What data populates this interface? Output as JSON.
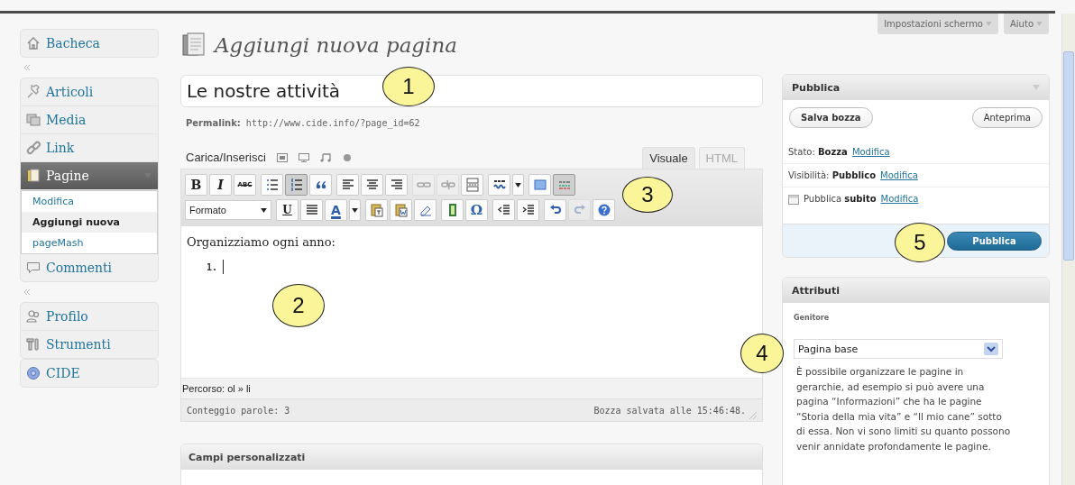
{
  "top_buttons": [
    {
      "label": "Impostazioni schermo"
    },
    {
      "label": "Aiuto"
    }
  ],
  "sidebar": {
    "groups": [
      {
        "separator_after": true,
        "items": [
          {
            "label": "Bacheca",
            "kind": "home",
            "selected": false
          }
        ]
      },
      {
        "separator_after": true,
        "items": [
          {
            "label": "Articoli",
            "kind": "pin",
            "selected": false
          },
          {
            "label": "Media",
            "kind": "media",
            "selected": false
          },
          {
            "label": "Link",
            "kind": "link",
            "selected": false
          },
          {
            "label": "Pagine",
            "kind": "pages",
            "selected": true,
            "children": [
              {
                "label": "Modifica",
                "selected": false
              },
              {
                "label": "Aggiungi nuova",
                "selected": true
              },
              {
                "label": "pageMash",
                "selected": false
              }
            ]
          },
          {
            "label": "Commenti",
            "kind": "comment",
            "selected": false
          }
        ]
      },
      {
        "separator_after": false,
        "items": [
          {
            "label": "Profilo",
            "kind": "users",
            "selected": false
          },
          {
            "label": "Strumenti",
            "kind": "tools",
            "selected": false
          }
        ]
      },
      {
        "separator_after": false,
        "items": [
          {
            "label": "CIDE",
            "kind": "flower",
            "selected": false
          }
        ]
      }
    ]
  },
  "page_title": "Aggiungi nuova pagina",
  "title_field": {
    "value": "Le nostre attività"
  },
  "permalink": {
    "label": "Permalink:",
    "url": "http://www.cide.info/?page_id=62"
  },
  "upload": {
    "label": "Carica/Inserisci"
  },
  "editor_tabs": [
    {
      "label": "Visuale",
      "selected": true
    },
    {
      "label": "HTML",
      "selected": false
    }
  ],
  "toolbar": {
    "rows": [
      {
        "groups": [
          {
            "buttons": [
              {
                "kind": "bold",
                "label": "B",
                "selected": false,
                "disabled": false
              },
              {
                "kind": "italic",
                "label": "I",
                "selected": false,
                "disabled": false
              },
              {
                "kind": "strike",
                "label": "ABC",
                "selected": false,
                "disabled": false
              }
            ]
          },
          {
            "buttons": [
              {
                "kind": "bullet-list",
                "selected": false,
                "disabled": false
              },
              {
                "kind": "numbered-list",
                "selected": true,
                "disabled": false
              },
              {
                "kind": "quote",
                "selected": false,
                "disabled": false
              }
            ]
          },
          {
            "buttons": [
              {
                "kind": "align-left",
                "selected": false,
                "disabled": false
              },
              {
                "kind": "align-center",
                "selected": false,
                "disabled": false
              },
              {
                "kind": "align-right",
                "selected": false,
                "disabled": false
              }
            ]
          },
          {
            "buttons": [
              {
                "kind": "link",
                "selected": false,
                "disabled": true
              },
              {
                "kind": "unlink",
                "selected": false,
                "disabled": true
              },
              {
                "kind": "page-break",
                "selected": false,
                "disabled": false
              }
            ]
          },
          {
            "buttons": [
              {
                "kind": "spelling",
                "selected": false,
                "disabled": false
              },
              {
                "kind": "dropdown",
                "selected": false,
                "disabled": false
              }
            ]
          },
          {
            "buttons": [
              {
                "kind": "fullscreen",
                "selected": false,
                "disabled": false
              },
              {
                "kind": "toolbar-toggle",
                "selected": true,
                "disabled": false
              }
            ]
          }
        ]
      },
      {
        "groups": [
          {
            "buttons": [
              {
                "kind": "format-select",
                "label": "Formato"
              }
            ]
          },
          {
            "buttons": [
              {
                "kind": "underline",
                "label": "U",
                "selected": false,
                "disabled": false
              },
              {
                "kind": "justify",
                "selected": false,
                "disabled": false
              },
              {
                "kind": "text-color",
                "label": "A",
                "selected": false,
                "disabled": false
              },
              {
                "kind": "dropdown",
                "selected": false,
                "disabled": false
              }
            ]
          },
          {
            "buttons": [
              {
                "kind": "paste-text",
                "selected": false,
                "disabled": false
              },
              {
                "kind": "paste-word",
                "selected": false,
                "disabled": false
              },
              {
                "kind": "eraser",
                "selected": false,
                "disabled": false
              }
            ]
          },
          {
            "buttons": [
              {
                "kind": "film",
                "selected": false,
                "disabled": false
              },
              {
                "kind": "symbol",
                "label": "Ω",
                "selected": false,
                "disabled": false
              }
            ]
          },
          {
            "buttons": [
              {
                "kind": "outdent",
                "selected": false,
                "disabled": false
              },
              {
                "kind": "indent",
                "selected": false,
                "disabled": false
              }
            ]
          },
          {
            "buttons": [
              {
                "kind": "undo",
                "selected": false,
                "disabled": false
              },
              {
                "kind": "redo",
                "selected": false,
                "disabled": true
              },
              {
                "kind": "help",
                "selected": false,
                "disabled": false
              }
            ]
          }
        ]
      }
    ]
  },
  "content": {
    "paragraph": "Organizziamo ogni anno:",
    "list_markers": [
      "1."
    ]
  },
  "path": "Percorso: ol » li",
  "status": {
    "word_count": "Conteggio parole: 3",
    "saved": "Bozza salvata alle 15:46:48."
  },
  "custom_fields": {
    "title": "Campi personalizzati"
  },
  "publish": {
    "title": "Pubblica",
    "save_draft": "Salva bozza",
    "preview": "Anteprima",
    "rows": [
      {
        "kind": "status",
        "text": "Stato: **Bozza**",
        "link": "Modifica"
      },
      {
        "kind": "status",
        "text": "Visibilità: **Pubblico**",
        "link": "Modifica"
      },
      {
        "kind": "schedule",
        "text": "Pubblica **subito**",
        "link": "Modifica"
      }
    ],
    "button": "Pubblica"
  },
  "attributes": {
    "title": "Attributi",
    "parent_label": "Genitore",
    "parent_value": "Pagina base",
    "help": "È possibile organizzare le pagine in gerarchie, ad esempio si può avere una pagina “Informazioni” che ha le pagine “Storia della mia vita” e “Il mio cane” sotto di essa. Non vi sono limiti su quanto possono venir annidate profondamente le pagine."
  },
  "callouts": [
    {
      "label": "1"
    },
    {
      "label": "2"
    },
    {
      "label": "3"
    },
    {
      "label": "4"
    },
    {
      "label": "5"
    }
  ]
}
